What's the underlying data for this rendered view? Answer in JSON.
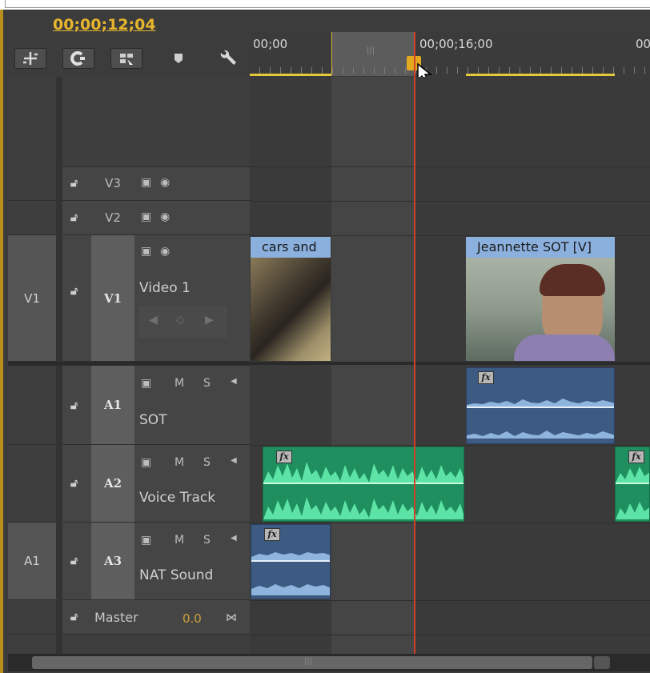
{
  "timecode": "00;00;12;04",
  "toolbar": {
    "buttons": [
      "snap-icon",
      "link-icon",
      "nest-icon",
      "marker-icon",
      "wrench-icon"
    ]
  },
  "ruler": {
    "labels": [
      "00;00",
      "00;00;16;00",
      "00"
    ],
    "workarea_grip": "|||"
  },
  "video_tracks": [
    {
      "name": "V3",
      "source": ""
    },
    {
      "name": "V2",
      "source": ""
    },
    {
      "name": "V1",
      "source": "V1",
      "label": "Video 1"
    }
  ],
  "audio_tracks": [
    {
      "name": "A1",
      "source": "",
      "label": "SOT",
      "m": "M",
      "s": "S"
    },
    {
      "name": "A2",
      "source": "",
      "label": "Voice Track",
      "m": "M",
      "s": "S"
    },
    {
      "name": "A3",
      "source": "A1",
      "label": "NAT Sound",
      "m": "M",
      "s": "S"
    }
  ],
  "master": {
    "label": "Master",
    "value": "0.0"
  },
  "clips": {
    "video": [
      {
        "title": "cars and"
      },
      {
        "title": "Jeannette SOT [V]"
      }
    ],
    "fx_label": "fx"
  },
  "scrollbar": {
    "grip": "|||"
  },
  "colors": {
    "timecode": "#e8b62d",
    "playhead": "#d04025",
    "video_clip_header": "#8bb0de",
    "audio_clip_blue": "#3d5a82",
    "audio_clip_green": "#2fb57f",
    "workarea_bar": "#e2c93a"
  }
}
